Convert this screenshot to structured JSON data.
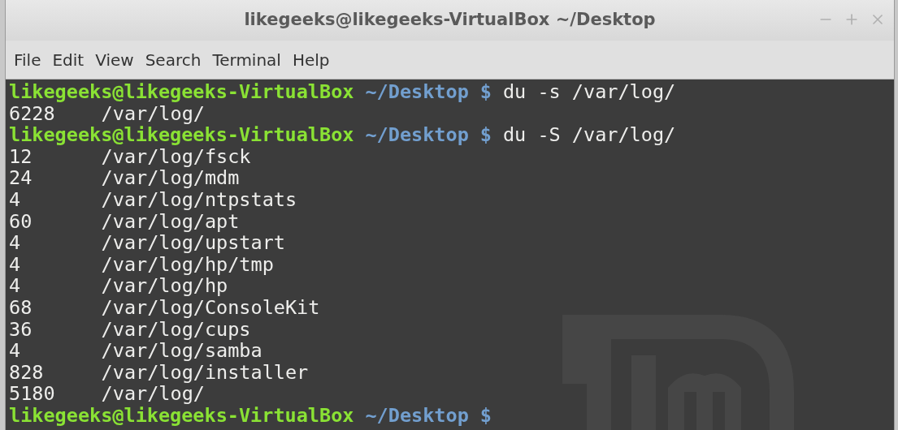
{
  "window": {
    "title": "likegeeks@likegeeks-VirtualBox ~/Desktop"
  },
  "menu": [
    "File",
    "Edit",
    "View",
    "Search",
    "Terminal",
    "Help"
  ],
  "terminal": {
    "lines": [
      {
        "kind": "prompt",
        "user_host": "likegeeks@likegeeks-VirtualBox",
        "path": "~/Desktop",
        "symbol": "$",
        "command": "du -s /var/log/"
      },
      {
        "kind": "output",
        "size": "6228",
        "path": "/var/log/"
      },
      {
        "kind": "prompt",
        "user_host": "likegeeks@likegeeks-VirtualBox",
        "path": "~/Desktop",
        "symbol": "$",
        "command": "du -S /var/log/"
      },
      {
        "kind": "output",
        "size": "12",
        "path": "/var/log/fsck"
      },
      {
        "kind": "output",
        "size": "24",
        "path": "/var/log/mdm"
      },
      {
        "kind": "output",
        "size": "4",
        "path": "/var/log/ntpstats"
      },
      {
        "kind": "output",
        "size": "60",
        "path": "/var/log/apt"
      },
      {
        "kind": "output",
        "size": "4",
        "path": "/var/log/upstart"
      },
      {
        "kind": "output",
        "size": "4",
        "path": "/var/log/hp/tmp"
      },
      {
        "kind": "output",
        "size": "4",
        "path": "/var/log/hp"
      },
      {
        "kind": "output",
        "size": "68",
        "path": "/var/log/ConsoleKit"
      },
      {
        "kind": "output",
        "size": "36",
        "path": "/var/log/cups"
      },
      {
        "kind": "output",
        "size": "4",
        "path": "/var/log/samba"
      },
      {
        "kind": "output",
        "size": "828",
        "path": "/var/log/installer"
      },
      {
        "kind": "output",
        "size": "5180",
        "path": "/var/log/"
      },
      {
        "kind": "prompt",
        "user_host": "likegeeks@likegeeks-VirtualBox",
        "path": "~/Desktop",
        "symbol": "$"
      }
    ]
  }
}
